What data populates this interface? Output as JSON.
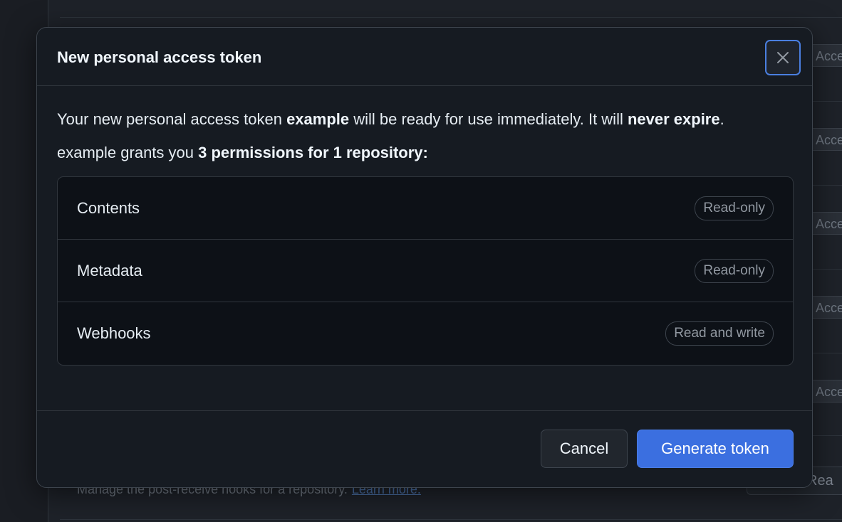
{
  "modal": {
    "title": "New personal access token",
    "intro": {
      "p1": "Your new personal access token ",
      "token_name": "example",
      "p2": " will be ready for use immediately. It will ",
      "expiry": "never expire",
      "p3": "."
    },
    "grants": {
      "token_name": "example",
      "text": " grants you ",
      "summary": "3 permissions for 1 repository:"
    },
    "permissions": [
      {
        "name": "Contents",
        "access": "Read-only"
      },
      {
        "name": "Metadata",
        "access": "Read-only"
      },
      {
        "name": "Webhooks",
        "access": "Read and write"
      }
    ],
    "footer": {
      "cancel_label": "Cancel",
      "generate_label": "Generate token"
    }
  },
  "background": {
    "button_label": "Access",
    "bottom_text": "Manage the post-receive hooks for a repository.",
    "bottom_link": "Learn more.",
    "bottom_button": "Rea"
  },
  "colors": {
    "accent": "#3b6fe0",
    "modal_bg": "#161b22",
    "page_bg": "#1e2229"
  },
  "icons": {
    "close": "close-icon"
  }
}
